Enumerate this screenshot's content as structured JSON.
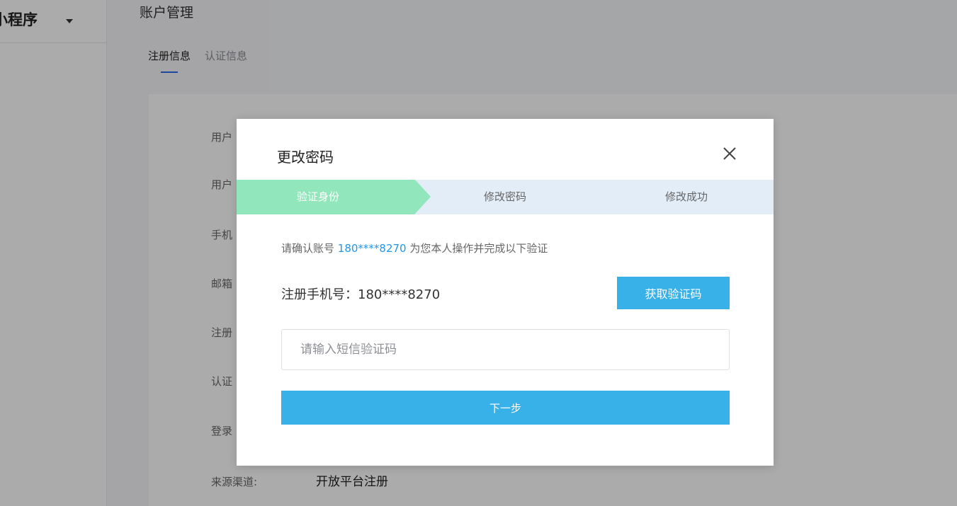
{
  "sidebar": {
    "app_name": "小程序"
  },
  "main": {
    "page_title": "账户管理",
    "tabs": [
      {
        "label": "注册信息",
        "active": true
      },
      {
        "label": "认证信息",
        "active": false
      }
    ],
    "info_rows": [
      {
        "label": "用户"
      },
      {
        "label": "用户"
      },
      {
        "label": "手机"
      },
      {
        "label": "邮箱"
      },
      {
        "label": "注册"
      },
      {
        "label": "认证"
      },
      {
        "label": "登录"
      },
      {
        "label": "来源渠道:",
        "value": "开放平台注册"
      }
    ]
  },
  "modal": {
    "title": "更改密码",
    "close_icon": "close-icon",
    "steps": [
      {
        "label": "验证身份",
        "active": true
      },
      {
        "label": "修改密码",
        "active": false
      },
      {
        "label": "修改成功",
        "active": false
      }
    ],
    "confirm_prefix": "请确认账号",
    "confirm_account": "180****8270",
    "confirm_suffix": "为您本人操作并完成以下验证",
    "phone_label": "注册手机号：180****8270",
    "get_code_label": "获取验证码",
    "code_input": {
      "value": "",
      "placeholder": "请输入短信验证码"
    },
    "next_label": "下一步"
  },
  "colors": {
    "accent": "#38b0e8",
    "link": "#2196e8",
    "step_active": "#92e6bc",
    "step_bar": "#e3edf8",
    "tab_indicator": "#2a6ce6"
  }
}
